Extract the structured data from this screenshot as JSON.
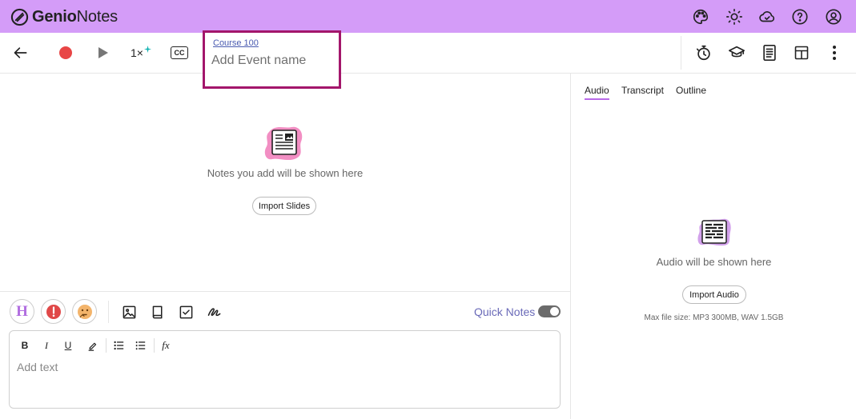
{
  "app": {
    "logo_bold": "Genio",
    "logo_light": "Notes"
  },
  "topbar": {
    "icons": [
      "palette-icon",
      "sun-icon",
      "cloud-icon",
      "help-icon",
      "account-icon"
    ]
  },
  "toolbar": {
    "playback_speed": "1×",
    "captions_label": "CC",
    "course_link": "Course 100",
    "event_placeholder": "Add Event name",
    "event_value": ""
  },
  "notes": {
    "empty_message": "Notes you add will be shown here",
    "import_button": "Import Slides",
    "quick_notes_label": "Quick Notes",
    "quick_notes_enabled": true,
    "heading_letter": "H",
    "editor_placeholder": "Add text",
    "format_bold": "B",
    "format_italic": "I",
    "format_underline": "U",
    "formula_label": "fx"
  },
  "side_panel": {
    "tabs": [
      {
        "label": "Audio",
        "active": true
      },
      {
        "label": "Transcript",
        "active": false
      },
      {
        "label": "Outline",
        "active": false
      }
    ],
    "empty_message": "Audio will be shown here",
    "import_button": "Import Audio",
    "file_limit_note": "Max file size: MP3 300MB, WAV 1.5GB"
  },
  "colors": {
    "topbar_bg": "#d49cf8",
    "record_red": "#e84545",
    "event_box_border": "#a3166b",
    "accent_purple": "#b868e8",
    "quick_notes_text": "#6a6ab8"
  }
}
